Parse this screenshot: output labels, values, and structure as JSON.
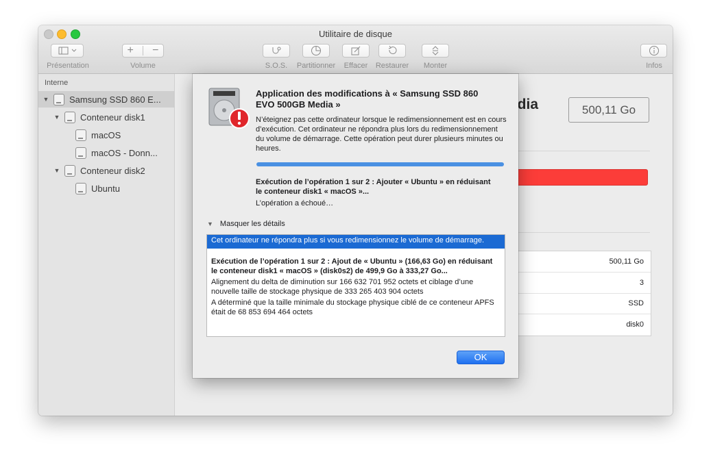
{
  "window": {
    "title": "Utilitaire de disque"
  },
  "toolbar": {
    "presentation_label": "Présentation",
    "volume_label": "Volume",
    "sos_label": "S.O.S.",
    "partition_label": "Partitionner",
    "erase_label": "Effacer",
    "restore_label": "Restaurer",
    "mount_label": "Monter",
    "info_label": "Infos"
  },
  "sidebar": {
    "header": "Interne",
    "items": [
      {
        "label": "Samsung SSD 860 E..."
      },
      {
        "label": "Conteneur disk1"
      },
      {
        "label": "macOS"
      },
      {
        "label": "macOS - Donn..."
      },
      {
        "label": "Conteneur disk2"
      },
      {
        "label": "Ubuntu"
      }
    ]
  },
  "main": {
    "title_fragment": "edia",
    "capacity_badge": "500,11 Go",
    "usage_bar_color": "#fc3d39",
    "info_values": [
      "500,11 Go",
      "3",
      "SSD",
      "disk0"
    ]
  },
  "dialog": {
    "title": "Application des modifications à « Samsung SSD 860 EVO 500GB Media »",
    "message": "N’éteignez pas cette ordinateur lorsque le redimensionnement est en cours d’exécution. Cet ordinateur ne répondra plus lors du redimensionnement du volume de démarrage. Cette opération peut durer plusieurs minutes ou heures.",
    "progress": 1.0,
    "operation": "Exécution de l’opération 1 sur 2 : Ajouter « Ubuntu » en réduisant le conteneur disk1 « macOS »...",
    "status": "L’opération a échoué…",
    "details_toggle": "Masquer les détails",
    "log": {
      "selected": "Cet ordinateur ne répondra plus si vous redimensionnez le volume de démarrage.",
      "op_heading": "Exécution de l’opération 1 sur 2 : Ajout de « Ubuntu » (166,63 Go) en réduisant le conteneur disk1 « macOS » (disk0s2) de 499,9 Go à 333,27 Go...",
      "line1": "Alignement du delta de diminution sur 166 632 701 952 octets et ciblage d’une nouvelle taille de stockage physique de 333 265 403 904 octets",
      "line2": "A déterminé que la taille minimale du stockage physique ciblé de ce conteneur APFS était de 68 853 694 464 octets"
    },
    "ok_label": "OK"
  },
  "colors": {
    "accent": "#1b6ad3",
    "alert": "#e0262b"
  }
}
